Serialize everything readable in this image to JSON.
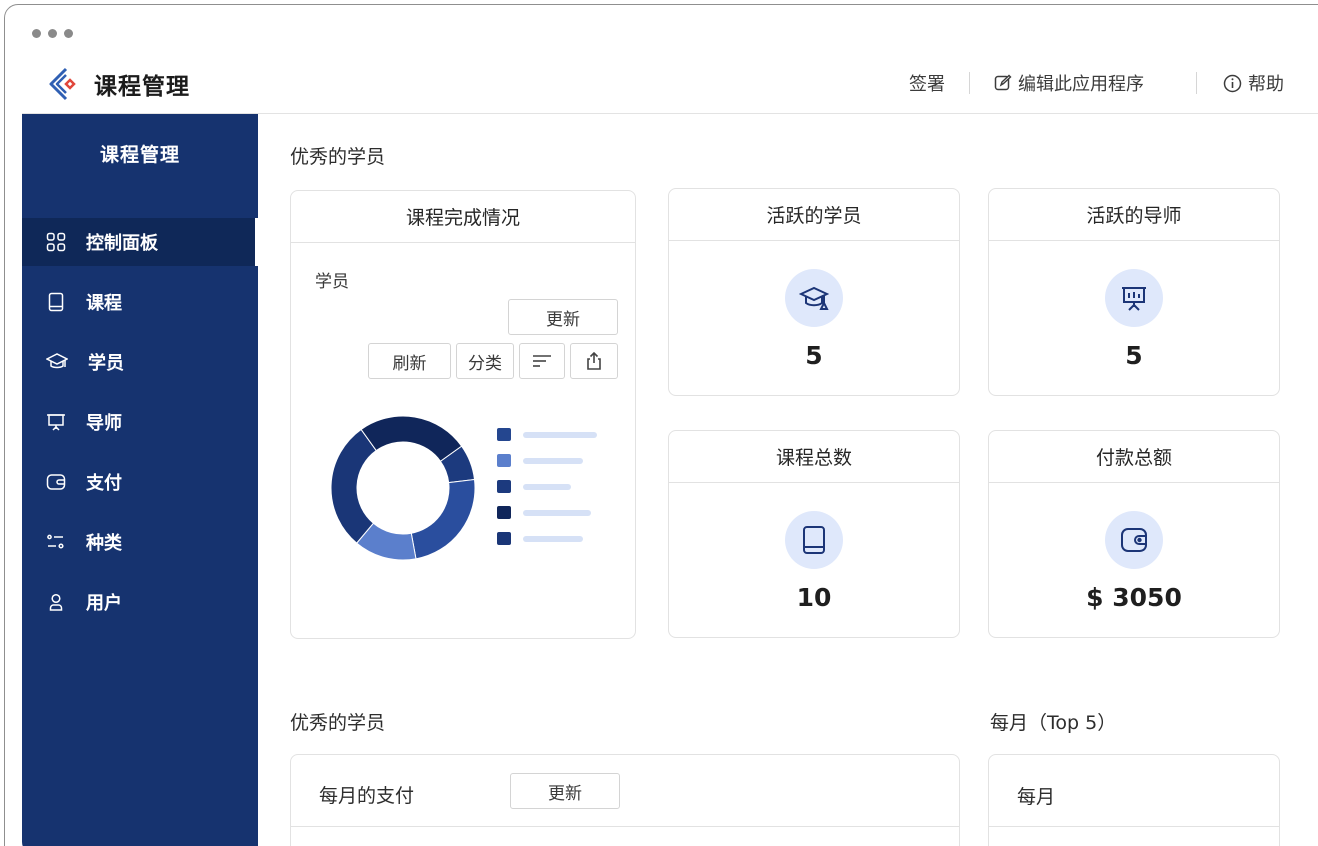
{
  "app": {
    "title": "课程管理"
  },
  "topbar": {
    "sign_label": "签署",
    "edit_label": "编辑此应用程序",
    "help_label": "帮助"
  },
  "sidebar": {
    "title": "课程管理",
    "items": [
      {
        "label": "控制面板",
        "icon": "grid-icon",
        "active": true
      },
      {
        "label": "课程",
        "icon": "book-icon",
        "active": false
      },
      {
        "label": "学员",
        "icon": "graduation-cap-icon",
        "active": false
      },
      {
        "label": "导师",
        "icon": "presentation-board-icon",
        "active": false
      },
      {
        "label": "支付",
        "icon": "wallet-icon",
        "active": false
      },
      {
        "label": "种类",
        "icon": "categories-icon",
        "active": false
      },
      {
        "label": "用户",
        "icon": "user-icon",
        "active": false
      }
    ]
  },
  "main": {
    "section1_title": "优秀的学员",
    "completion_card": {
      "title": "课程完成情况",
      "subtitle": "学员",
      "update_label": "更新",
      "refresh_label": "刷新",
      "category_label": "分类"
    },
    "stats": [
      {
        "title": "活跃的学员",
        "value": "5",
        "icon": "graduation-cap-icon"
      },
      {
        "title": "活跃的导师",
        "value": "5",
        "icon": "presentation-board-icon"
      },
      {
        "title": "课程总数",
        "value": "10",
        "icon": "book-icon"
      },
      {
        "title": "付款总额",
        "value": "$ 3050",
        "icon": "wallet-icon"
      }
    ],
    "section2_title": "优秀的学员",
    "section3_title": "每月（Top 5）",
    "payments_card": {
      "title": "每月的支付",
      "update_label": "更新"
    },
    "monthly_card": {
      "title": "每月"
    }
  },
  "colors": {
    "sidebar_bg": "#16336f",
    "sidebar_active": "#0f2858",
    "icon_circle": "#dfe8fb",
    "accent_red": "#e0463b"
  },
  "chart_data": {
    "type": "pie",
    "title": "",
    "values": [
      {
        "fraction": 0.08,
        "color": "#1c3a7e"
      },
      {
        "fraction": 0.24,
        "color": "#2a4e9e"
      },
      {
        "fraction": 0.14,
        "color": "#5b7fcc"
      },
      {
        "fraction": 0.29,
        "color": "#1a3677"
      },
      {
        "fraction": 0.25,
        "color": "#10265a"
      }
    ],
    "legend_colors": [
      "#24468f",
      "#5b7fcc",
      "#1c3a7e",
      "#10265a",
      "#1a3677"
    ]
  }
}
